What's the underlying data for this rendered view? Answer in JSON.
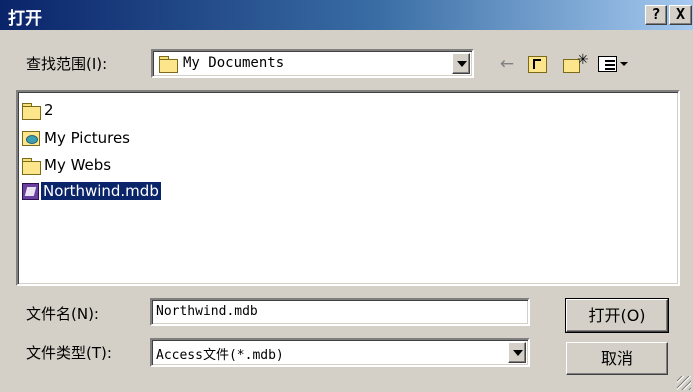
{
  "window": {
    "title": "打开",
    "help_btn": "?",
    "close_btn": "X"
  },
  "lookin": {
    "label": "查找范围(I):",
    "value": "My Documents",
    "icon": "folder-open-icon"
  },
  "toolbar": {
    "back_icon": "back-arrow-icon",
    "up_icon": "up-one-level-icon",
    "newfolder_icon": "new-folder-icon",
    "views_icon": "views-menu-icon"
  },
  "files": [
    {
      "name": "2",
      "icon": "folder-icon"
    },
    {
      "name": "My Pictures",
      "icon": "pictures-folder-icon"
    },
    {
      "name": "My Webs",
      "icon": "folder-icon"
    },
    {
      "name": "Northwind.mdb",
      "icon": "access-db-icon",
      "selected": true
    }
  ],
  "filename": {
    "label": "文件名(N):",
    "value": "Northwind.mdb"
  },
  "filetype": {
    "label": "文件类型(T):",
    "value": "Access文件(*.mdb)"
  },
  "buttons": {
    "open": "打开(O)",
    "cancel": "取消"
  }
}
